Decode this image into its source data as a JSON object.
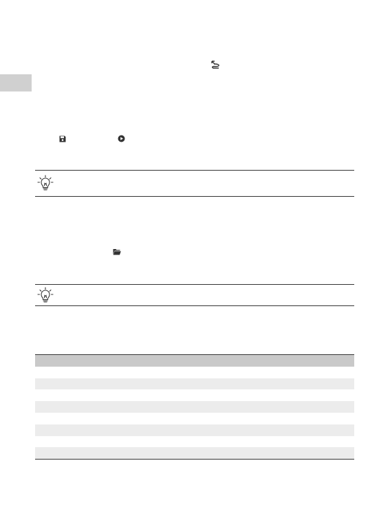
{
  "page": {
    "colors": {
      "side_tab": "#d0d0d0",
      "table_header": "#c9c9c9",
      "table_row_shaded": "#ececec",
      "rule": "#333333"
    },
    "icons": [
      "waypoint-route-icon",
      "save-icon",
      "play-circle-icon",
      "lightbulb-tip-icon",
      "folder-open-icon"
    ],
    "tips": [
      {
        "text": ""
      },
      {
        "text": ""
      }
    ],
    "table": {
      "header": "",
      "rows": [
        "",
        "",
        "",
        "",
        "",
        "",
        "",
        ""
      ]
    }
  }
}
